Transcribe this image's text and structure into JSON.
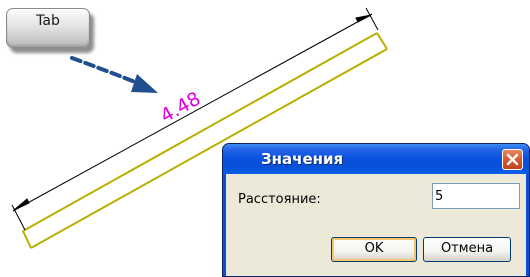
{
  "drawing": {
    "dimension_value": "4.48",
    "dimension_color": "#e000e0",
    "line_color": "#b8b000"
  },
  "key_hint": {
    "key_label": "Tab",
    "icon": "dashed-arrow-icon",
    "arrow_color": "#1f4f8f"
  },
  "dialog": {
    "title": "Значения",
    "close_icon": "close-icon",
    "field_label": "Расстояние:",
    "field_value": "5",
    "ok_label": "OK",
    "cancel_label": "Отмена"
  }
}
